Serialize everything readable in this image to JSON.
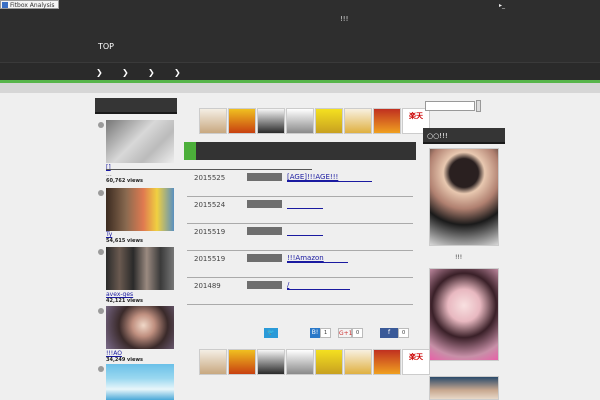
{
  "header": {
    "fitbox_label": "Fitbox Analysis",
    "mark": "!!!",
    "corner_mark": "▸_",
    "top_link": "TOP"
  },
  "nav": {
    "items": [
      "❯",
      "❯",
      "❯",
      "❯"
    ]
  },
  "ranking": {
    "items": [
      {
        "title": "[]",
        "sub": "...",
        "views": "60,762 views"
      },
      {
        "title": "Ty",
        "sub": "",
        "views": "54,615 views"
      },
      {
        "title": "avex-ges",
        "sub": "",
        "views": "42,121 views"
      },
      {
        "title": "!!!AO",
        "sub": "",
        "views": "34,249 views"
      }
    ]
  },
  "news": {
    "rows": [
      {
        "date": "2015525",
        "title": "[AGE]!!!AGE!!!"
      },
      {
        "date": "2015524",
        "title": ""
      },
      {
        "date": "2015519",
        "title": ""
      },
      {
        "date": "2015519",
        "title": "!!!Amazon"
      },
      {
        "date": "201489",
        "title": "/"
      }
    ]
  },
  "share": {
    "twitter_label": "🐦",
    "hatena_label": "B!",
    "hatena_count": "1",
    "gplus_label": "G+1",
    "gplus_count": "0",
    "facebook_label": "f",
    "facebook_count": "0"
  },
  "banners": {
    "rakuten_label": "楽天"
  },
  "right": {
    "heading": "○○!!!",
    "caption": "!!!"
  }
}
